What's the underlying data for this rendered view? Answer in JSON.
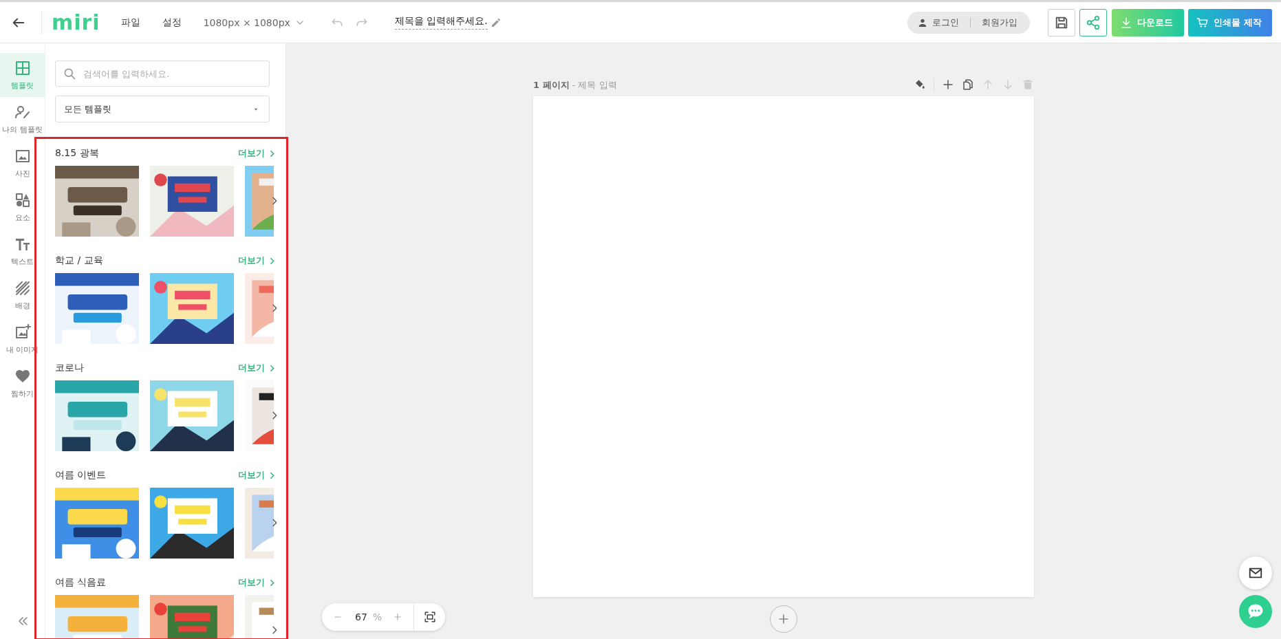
{
  "topbar": {
    "logo": "miri",
    "menu": [
      "파일",
      "설정"
    ],
    "size": "1080px × 1080px",
    "history": [
      {
        "kind": "undo",
        "disabled": true
      },
      {
        "kind": "redo",
        "disabled": true
      }
    ],
    "title": "제목을 입력해주세요.",
    "auth": {
      "login": "로그인",
      "signup": "회원가입"
    },
    "actions": [
      {
        "kind": "save"
      },
      {
        "kind": "share"
      },
      {
        "kind": "download",
        "label": "다운로드"
      },
      {
        "kind": "print",
        "label": "인쇄물 제작"
      }
    ]
  },
  "sidebar": {
    "items": [
      {
        "kind": "template",
        "label": "템플릿",
        "selected": true
      },
      {
        "kind": "my-template",
        "label": "나의 템플릿",
        "selected": false
      },
      {
        "label": "사진",
        "selected": false
      },
      {
        "kind": "elements",
        "label": "요소",
        "selected": false
      },
      {
        "kind": "text",
        "label": "텍스트",
        "selected": false
      },
      {
        "kind": "background",
        "label": "배경",
        "selected": false
      },
      {
        "kind": "my-image",
        "label": "내 이미지",
        "selected": false
      },
      {
        "kind": "likes",
        "label": "찜하기",
        "selected": false
      }
    ]
  },
  "panel": {
    "search": {
      "placeholder": "검색어를 입력하세요."
    },
    "category": {
      "value": "모든 템플릿"
    },
    "sections": [
      {
        "title": "8.15 광복",
        "more": "더보기"
      },
      {
        "title": "학교 / 교육",
        "more": "더보기"
      },
      {
        "title": "코로나",
        "more": "더보기"
      },
      {
        "title": "여름 이벤트",
        "more": "더보기"
      },
      {
        "title": "여름 식음료",
        "more": "더보기"
      }
    ]
  },
  "canvas": {
    "page_number": "1 페이지",
    "page_title": "- 제목 입력",
    "tools": [
      {
        "kind": "fill",
        "disabled": false
      },
      {
        "kind": "add",
        "disabled": false
      },
      {
        "kind": "copy",
        "disabled": false
      },
      {
        "kind": "up",
        "disabled": true
      },
      {
        "kind": "down",
        "disabled": true
      },
      {
        "kind": "delete",
        "disabled": true
      }
    ],
    "zoom": {
      "value": "67",
      "unit": "%"
    }
  },
  "annotation": {
    "highlight_frame": true
  }
}
